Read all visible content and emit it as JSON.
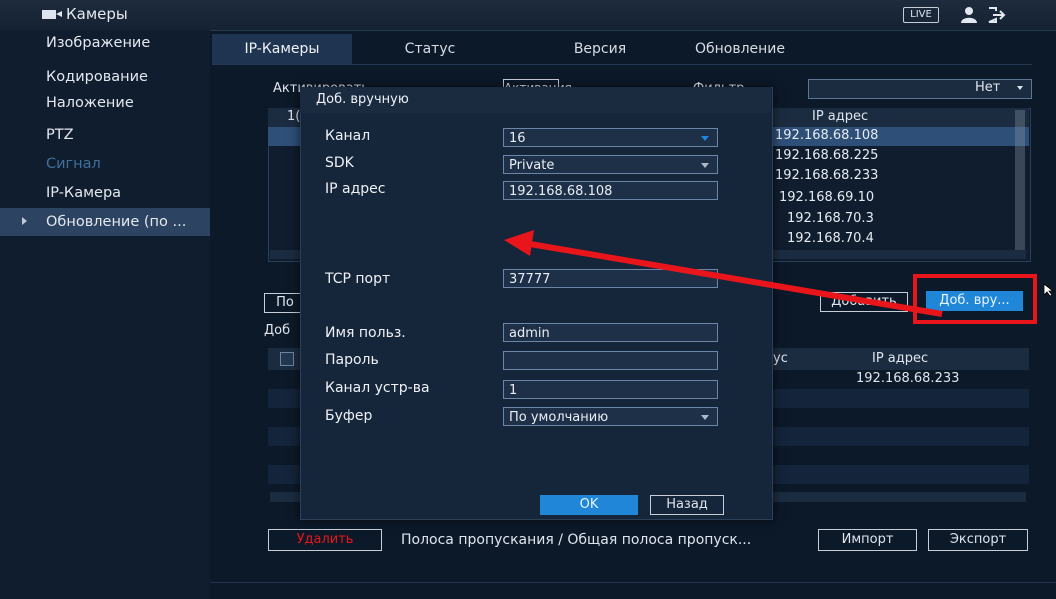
{
  "header": {
    "title": "Камеры",
    "live_badge": "LIVE"
  },
  "sidebar": {
    "items": [
      {
        "label": "Изображение"
      },
      {
        "label": "Кодирование"
      },
      {
        "label": "Наложение"
      },
      {
        "label": "PTZ"
      },
      {
        "label": "Сигнал"
      },
      {
        "label": "IP-Камера"
      },
      {
        "label": "Обновление (по ..."
      }
    ]
  },
  "tabs": [
    {
      "label": "IP-Камеры"
    },
    {
      "label": "Статус"
    },
    {
      "label": "Версия"
    },
    {
      "label": "Обновление"
    }
  ],
  "bg": {
    "activate_label": "Активировать",
    "activate_button": "Активация",
    "filter_label": "Фильтр",
    "filter_value": "Нет",
    "col_ip_header": "IP адрес",
    "col_first_header": "1(",
    "ips": [
      "192.168.68.108",
      "192.168.68.225",
      "192.168.68.233",
      "192.168.69.10",
      "192.168.70.3",
      "192.168.70.4"
    ],
    "add_button": "Добавить",
    "manual_add_button": "Доб. вру...",
    "search_button": "По",
    "added_label": "Доб",
    "status_col": "ус",
    "added_ip_header": "IP адрес",
    "added_ip": "192.168.68.233",
    "delete_button": "Удалить",
    "bandwidth_text": "Полоса пропускания / Общая полоса пропуск...",
    "import_button": "Импорт",
    "export_button": "Экспорт"
  },
  "modal": {
    "title": "Доб. вручную",
    "channel_label": "Канал",
    "channel_value": "16",
    "sdk_label": "SDK",
    "sdk_value": "Private",
    "ip_label": "IP адрес",
    "ip_value": "192.168.68.108",
    "tcp_label": "TCP порт",
    "tcp_value": "37777",
    "user_label": "Имя польз.",
    "user_value": "admin",
    "password_label": "Пароль",
    "password_value": "",
    "device_channel_label": "Канал устр-ва",
    "device_channel_value": "1",
    "buffer_label": "Буфер",
    "buffer_value": "По умолчанию",
    "ok_button": "OK",
    "back_button": "Назад"
  },
  "colors": {
    "accent": "#1f86d8",
    "annotation": "#e8151a",
    "background": "#0c1929"
  }
}
